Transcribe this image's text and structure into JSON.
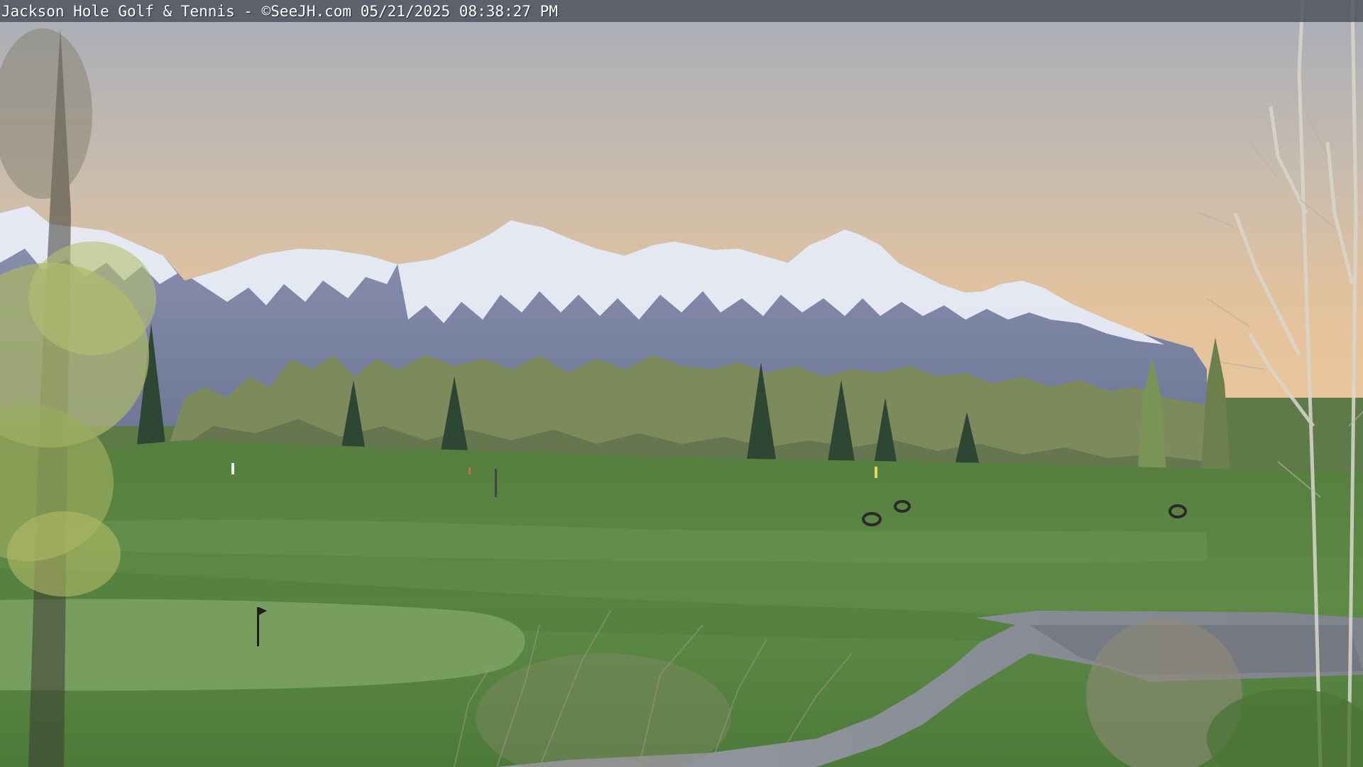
{
  "camera": {
    "overlay_text": "Jackson Hole Golf & Tennis - ©SeeJH.com 05/21/2025 08:38:27 PM"
  },
  "scene": {
    "colors": {
      "sky_top": "#a9aeb8",
      "sky_glow": "#dfc09e",
      "snow": "#eef0f6",
      "rock": "#7c84a4",
      "fairway": "#5f8a47",
      "putting_green": "#73995a",
      "cart_path": "#8a8e96",
      "conifer": "#2f4a35",
      "aspen_leaves": "#a9b46a"
    }
  }
}
